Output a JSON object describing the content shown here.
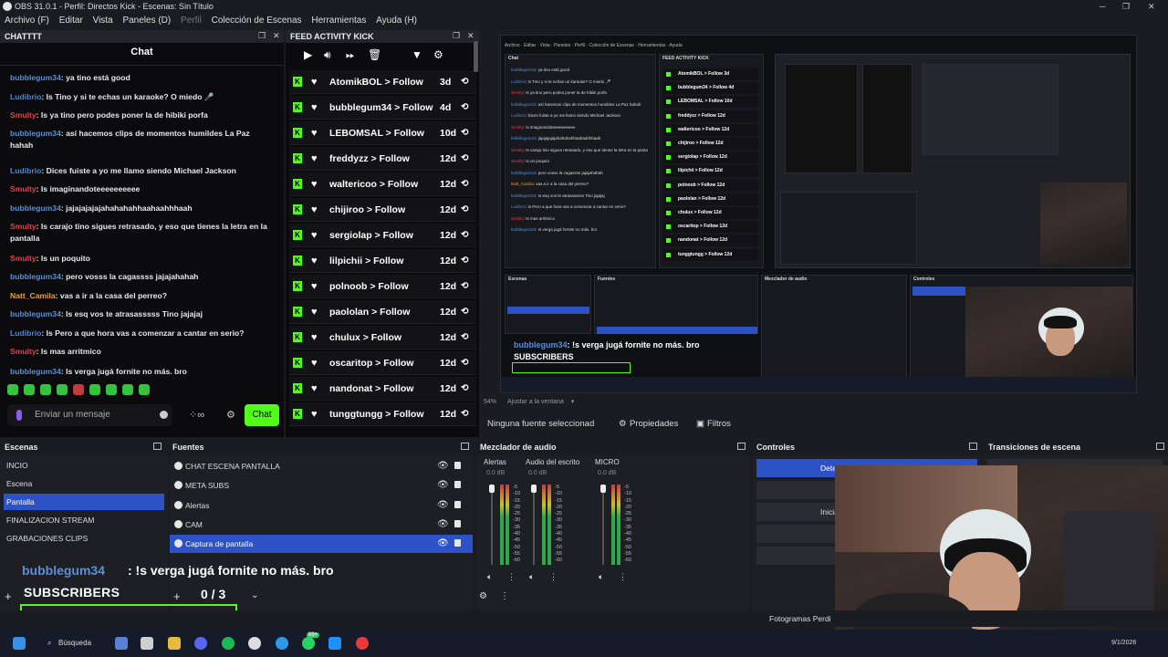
{
  "window": {
    "title": "OBS 31.0.1 - Perfil: Directos Kick - Escenas: Sin Título"
  },
  "menu": [
    "Archivo (F)",
    "Editar",
    "Vista",
    "Paneles (D)",
    "Perfil",
    "Colección de Escenas",
    "Herramientas",
    "Ayuda (H)"
  ],
  "chat_dock": {
    "title": "CHATTTT",
    "heading": "Chat",
    "input_placeholder": "Enviar un mensaje",
    "send_label": "Chat",
    "messages": [
      {
        "user": "bubblegum34",
        "color": "#5b8ed6",
        "text": ": ya tino está good"
      },
      {
        "user": "Ludibrio",
        "color": "#4a86d8",
        "text": ": Is Tino y si te echas un karaoke? O miedo 🎤"
      },
      {
        "user": "Smulty",
        "color": "#e0424b",
        "text": ": Is ya tino pero podes poner la de hibiki porfa"
      },
      {
        "user": "bubblegum34",
        "color": "#5b8ed6",
        "text": ": así hacemos clips de momentos humildes La Paz hahah"
      },
      {
        "user": "Ludibrio",
        "color": "#4a86d8",
        "text": ": Dices fuiste a yo me llamo siendo Michael Jackson"
      },
      {
        "user": "Smulty",
        "color": "#e0424b",
        "text": ": Is imaginandoteeeeeeeeee"
      },
      {
        "user": "bubblegum34",
        "color": "#5b8ed6",
        "text": ": jajajajajajahahahahhaahaahhhaah"
      },
      {
        "user": "Smulty",
        "color": "#e0424b",
        "text": ": Is carajo tino sigues retrasado, y eso que tienes la letra en la pantalla"
      },
      {
        "user": "Smulty",
        "color": "#e0424b",
        "text": ": Is un poquito"
      },
      {
        "user": "bubblegum34",
        "color": "#5b8ed6",
        "text": ": pero vosss la cagassss jajajahahah"
      },
      {
        "user": "Natt_Camila",
        "color": "#e8a03a",
        "text": ": vas a ir a la casa del perreo?"
      },
      {
        "user": "bubblegum34",
        "color": "#5b8ed6",
        "text": ": Is esq vos te atrasasssss Tino jajajaj"
      },
      {
        "user": "Ludibrio",
        "color": "#4a86d8",
        "text": ": Is Pero a que hora vas a comenzar a cantar en serio?"
      },
      {
        "user": "Smulty",
        "color": "#e0424b",
        "text": ": Is mas arritmico"
      },
      {
        "user": "bubblegum34",
        "color": "#5b8ed6",
        "text": ": Is verga jugá fornite no más. bro"
      }
    ]
  },
  "feed_dock": {
    "title": "FEED ACTIVITY KICK",
    "rows": [
      {
        "name": "AtomikBOL > Follow",
        "time": "3d"
      },
      {
        "name": "bubblegum34 > Follow",
        "time": "4d"
      },
      {
        "name": "LEBOMSAL > Follow",
        "time": "10d"
      },
      {
        "name": "freddyzz > Follow",
        "time": "12d"
      },
      {
        "name": "waltericoo > Follow",
        "time": "12d"
      },
      {
        "name": "chijiroo > Follow",
        "time": "12d"
      },
      {
        "name": "sergiolap > Follow",
        "time": "12d"
      },
      {
        "name": "lilpichii > Follow",
        "time": "12d"
      },
      {
        "name": "polnoob > Follow",
        "time": "12d"
      },
      {
        "name": "paololan > Follow",
        "time": "12d"
      },
      {
        "name": "chulux > Follow",
        "time": "12d"
      },
      {
        "name": "oscaritop > Follow",
        "time": "12d"
      },
      {
        "name": "nandonat > Follow",
        "time": "12d"
      },
      {
        "name": "tunggtungg > Follow",
        "time": "12d"
      }
    ]
  },
  "preview": {
    "zoom": "54%",
    "fit": "Ajustar a la ventana"
  },
  "source_bar": {
    "none": "Ninguna fuente seleccionad",
    "props": "Propiedades",
    "filters": "Filtros"
  },
  "docks": {
    "scenes": "Escenas",
    "sources": "Fuentes",
    "mixer": "Mezclador de audio",
    "controls": "Controles",
    "transitions": "Transiciones de escena"
  },
  "scenes": [
    "INCIO",
    "Escena",
    "Pantalla",
    "FINALIZACION STREAM",
    "GRABACIONES CLIPS"
  ],
  "selected_scene": "Pantalla",
  "sources": [
    "CHAT ESCENA PANTALLA",
    "META SUBS",
    "Alertas",
    "CAM",
    "Captura de pantalla"
  ],
  "mixer": [
    {
      "name": "Alertas",
      "db": "0.0 dB"
    },
    {
      "name": "Audio del escrito",
      "db": "0.0 dB"
    },
    {
      "name": "MICRO",
      "db": "0.0 dB"
    }
  ],
  "mixer_scale": [
    "-5",
    "-10",
    "-15",
    "-20",
    "-25",
    "-30",
    "-35",
    "-40",
    "-45",
    "-50",
    "-55",
    "-60"
  ],
  "controls": {
    "stop": "Dete",
    "start": "Inicia"
  },
  "overlay": {
    "user": "bubblegum34",
    "message": ": !s verga jugá fornite no más. bro",
    "subs_label": "SUBSCRIBERS",
    "subs_count": "0 / 3"
  },
  "status": {
    "frames": "Fotogramas Perdi"
  },
  "taskbar": {
    "search": "Búsqueda",
    "date": "9/1/2026",
    "badge": "99+"
  }
}
